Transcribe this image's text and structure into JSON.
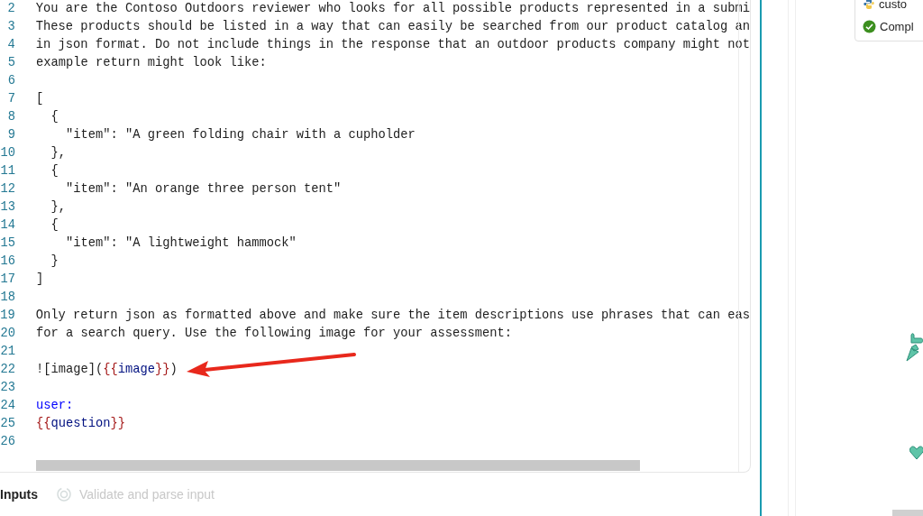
{
  "editor": {
    "lines": [
      {
        "number": "2",
        "segments": [
          {
            "kind": "plain",
            "text": "You are the Contoso Outdoors reviewer who looks for all possible products represented in a submi"
          }
        ]
      },
      {
        "number": "3",
        "segments": [
          {
            "kind": "plain",
            "text": "These products should be listed in a way that can easily be searched from our product catalog an"
          }
        ]
      },
      {
        "number": "4",
        "segments": [
          {
            "kind": "plain",
            "text": "in json format. Do not include things in the response that an outdoor products company might not"
          }
        ]
      },
      {
        "number": "5",
        "segments": [
          {
            "kind": "plain",
            "text": "example return might look like:"
          }
        ]
      },
      {
        "number": "6"
      },
      {
        "number": "7",
        "segments": [
          {
            "kind": "plain",
            "text": "["
          }
        ]
      },
      {
        "number": "8",
        "segments": [
          {
            "kind": "plain",
            "text": "  {"
          }
        ]
      },
      {
        "number": "9",
        "segments": [
          {
            "kind": "plain",
            "text": "    \"item\": \"A green folding chair with a cupholder"
          }
        ]
      },
      {
        "number": "10",
        "segments": [
          {
            "kind": "plain",
            "text": "  },"
          }
        ]
      },
      {
        "number": "11",
        "segments": [
          {
            "kind": "plain",
            "text": "  {"
          }
        ]
      },
      {
        "number": "12",
        "segments": [
          {
            "kind": "plain",
            "text": "    \"item\": \"An orange three person tent\""
          }
        ]
      },
      {
        "number": "13",
        "segments": [
          {
            "kind": "plain",
            "text": "  },"
          }
        ]
      },
      {
        "number": "14",
        "segments": [
          {
            "kind": "plain",
            "text": "  {"
          }
        ]
      },
      {
        "number": "15",
        "segments": [
          {
            "kind": "plain",
            "text": "    \"item\": \"A lightweight hammock\""
          }
        ]
      },
      {
        "number": "16",
        "segments": [
          {
            "kind": "plain",
            "text": "  }"
          }
        ]
      },
      {
        "number": "17",
        "segments": [
          {
            "kind": "plain",
            "text": "]"
          }
        ]
      },
      {
        "number": "18"
      },
      {
        "number": "19",
        "segments": [
          {
            "kind": "plain",
            "text": "Only return json as formatted above and make sure the item descriptions use phrases that can eas"
          }
        ]
      },
      {
        "number": "20",
        "segments": [
          {
            "kind": "plain",
            "text": "for a search query. Use the following image for your assessment:"
          }
        ]
      },
      {
        "number": "21"
      },
      {
        "number": "22",
        "segments": [
          {
            "kind": "plain",
            "text": "![image]("
          },
          {
            "kind": "brace",
            "text": "{{"
          },
          {
            "kind": "variable",
            "text": "image"
          },
          {
            "kind": "brace",
            "text": "}}"
          },
          {
            "kind": "plain",
            "text": ")"
          }
        ]
      },
      {
        "number": "23"
      },
      {
        "number": "24",
        "segments": [
          {
            "kind": "keyword",
            "text": "user:"
          }
        ]
      },
      {
        "number": "25",
        "segments": [
          {
            "kind": "brace",
            "text": "{{"
          },
          {
            "kind": "variable",
            "text": "question"
          },
          {
            "kind": "brace",
            "text": "}}"
          }
        ]
      },
      {
        "number": "26"
      }
    ]
  },
  "bottom_tabs": [
    {
      "label": "Inputs",
      "disabled": false
    },
    {
      "label": "Validate and parse input",
      "disabled": true
    }
  ],
  "side_card": {
    "items": [
      {
        "kind": "python",
        "label": "custo"
      },
      {
        "kind": "status",
        "label": "Compl"
      }
    ]
  }
}
